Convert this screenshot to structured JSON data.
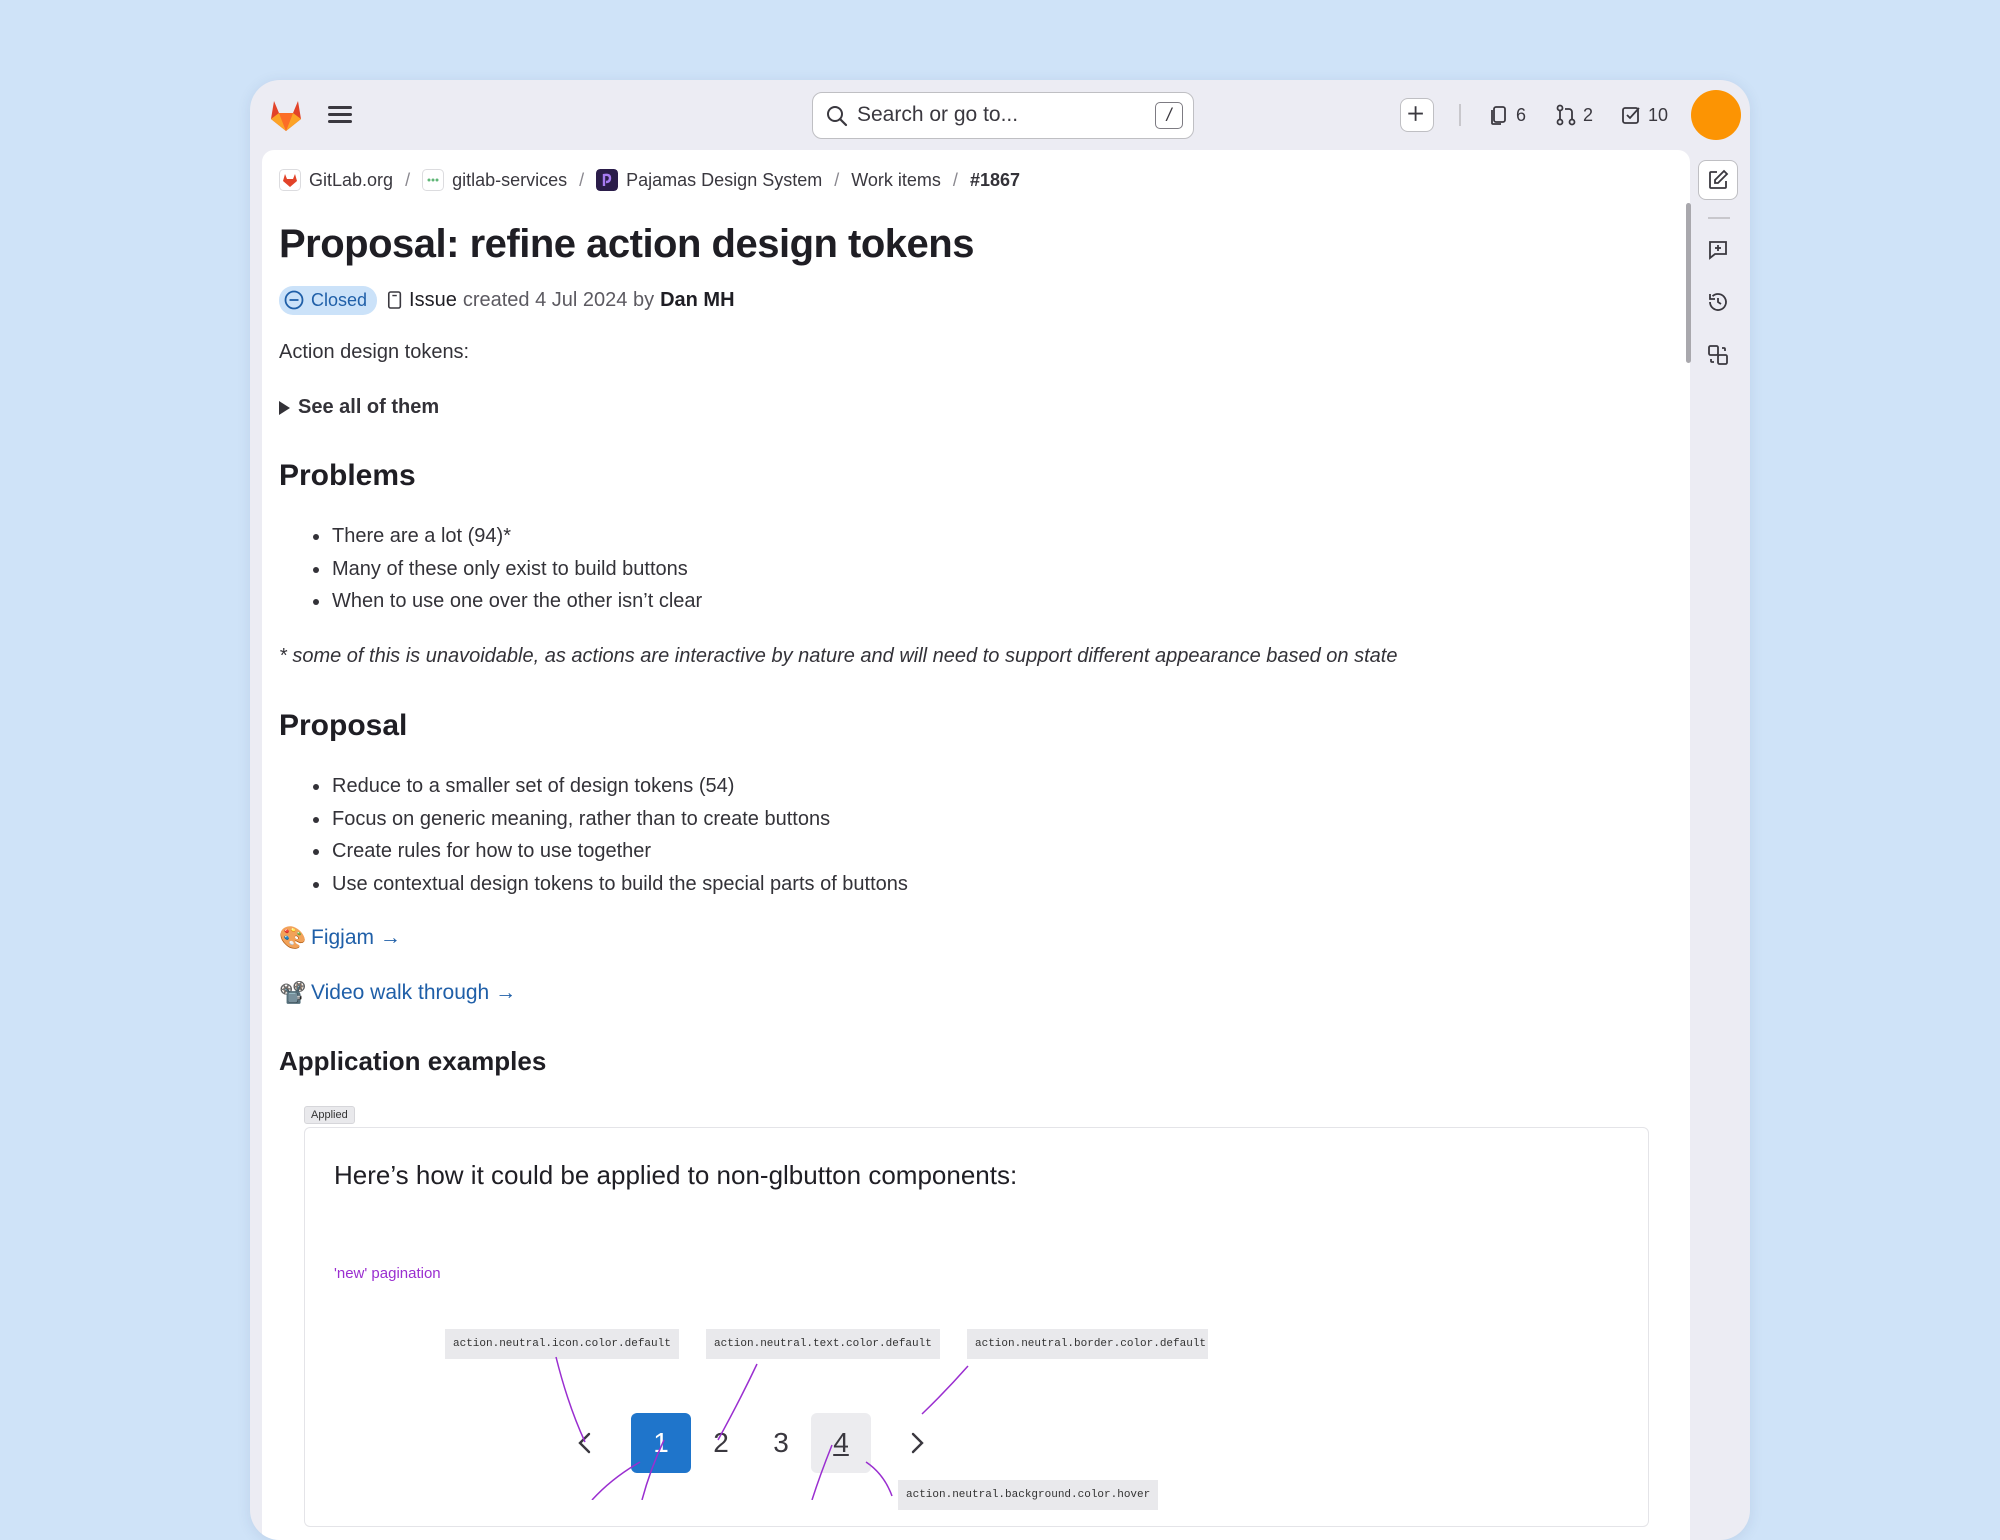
{
  "topbar": {
    "search_placeholder": "Search or go to...",
    "search_shortcut": "/",
    "counters": [
      {
        "icon": "issues-icon",
        "count": "6"
      },
      {
        "icon": "merge-request-icon",
        "count": "2"
      },
      {
        "icon": "todo-icon",
        "count": "10"
      }
    ],
    "avatar_color": "#fc9403"
  },
  "breadcrumb": {
    "items": [
      "GitLab.org",
      "gitlab-services",
      "Pajamas Design System",
      "Work items"
    ],
    "current": "#1867",
    "separator": "/"
  },
  "issue": {
    "title": "Proposal: refine action design tokens",
    "status": "Closed",
    "type": "Issue",
    "created_text": "created 4 Jul 2024 by",
    "author": "Dan MH"
  },
  "body": {
    "intro": "Action design tokens:",
    "details_summary": "See all of them",
    "problems_heading": "Problems",
    "problems": [
      "There are a lot (94)*",
      "Many of these only exist to build buttons",
      "When to use one over the other isn’t clear"
    ],
    "footnote": "* some of this is unavoidable, as actions are interactive by nature and will need to support different appearance based on state",
    "proposal_heading": "Proposal",
    "proposal": [
      "Reduce to a smaller set of design tokens (54)",
      "Focus on generic meaning, rather than to create buttons",
      "Create rules for how to use together",
      "Use contextual design tokens to build the special parts of buttons"
    ],
    "figjam_emoji": "🎨",
    "figjam_link": "Figjam →",
    "video_emoji": "📽️",
    "video_link": "Video walk through →",
    "examples_heading": "Application examples"
  },
  "example_image": {
    "tag": "Applied",
    "heading": "Here’s how it could be applied to non-glbutton components:",
    "subheading": "'new' pagination",
    "tokens": [
      "action.neutral.icon.color.default",
      "action.neutral.text.color.default",
      "action.neutral.border.color.default",
      "action.neutral.background.color.hover"
    ],
    "pages": [
      "1",
      "2",
      "3",
      "4"
    ],
    "active_page": "1",
    "accent_color": "#9a2ed0",
    "active_color": "#1f75cb"
  }
}
